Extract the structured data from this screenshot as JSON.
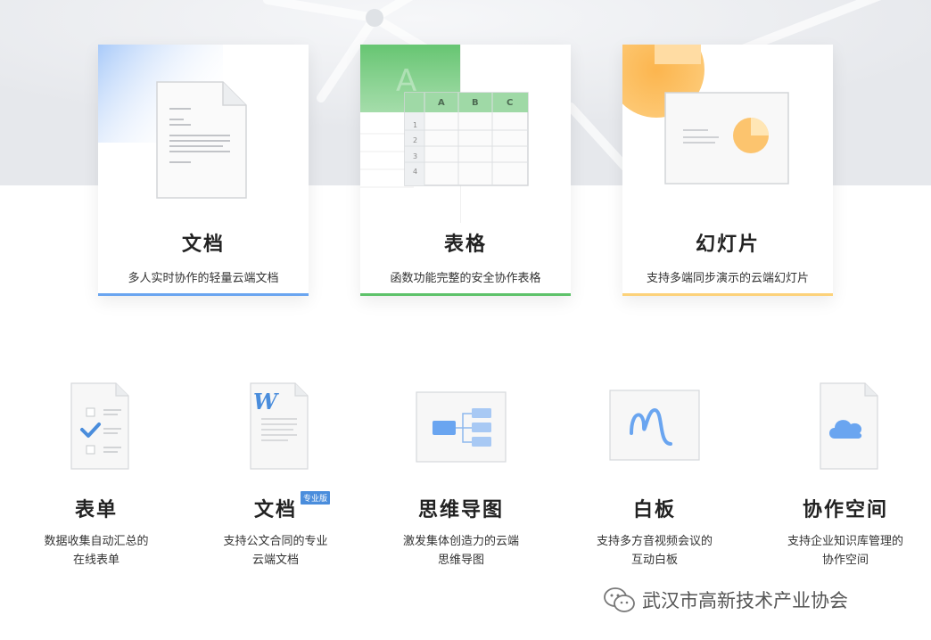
{
  "cards": [
    {
      "title": "文档",
      "desc": "多人实时协作的轻量云端文档",
      "accent": "#6aa5f0",
      "icon": "document-icon"
    },
    {
      "title": "表格",
      "desc": "函数功能完整的安全协作表格",
      "accent": "#5ec26a",
      "icon": "spreadsheet-icon",
      "columns": [
        "A",
        "B",
        "C"
      ],
      "rows": [
        "1",
        "2",
        "3",
        "4"
      ],
      "watermark_letter": "A"
    },
    {
      "title": "幻灯片",
      "desc": "支持多端同步演示的云端幻灯片",
      "accent": "#fcd27a",
      "icon": "slides-icon"
    }
  ],
  "items": [
    {
      "title": "表单",
      "desc_line1": "数据收集自动汇总的",
      "desc_line2": "在线表单",
      "icon": "form-checklist-icon"
    },
    {
      "title": "文档",
      "badge": "专业版",
      "desc_line1": "支持公文合同的专业",
      "desc_line2": "云端文档",
      "icon": "word-document-icon",
      "icon_letter": "W"
    },
    {
      "title": "思维导图",
      "desc_line1": "激发集体创造力的云端",
      "desc_line2": "思维导图",
      "icon": "mind-map-icon"
    },
    {
      "title": "白板",
      "desc_line1": "支持多方音视频会议的",
      "desc_line2": "互动白板",
      "icon": "whiteboard-icon"
    },
    {
      "title": "协作空间",
      "desc_line1": "支持企业知识库管理的",
      "desc_line2": "协作空间",
      "icon": "cloud-space-icon"
    }
  ],
  "watermark": {
    "text": "武汉市高新技术产业协会",
    "icon": "wechat-icon"
  }
}
